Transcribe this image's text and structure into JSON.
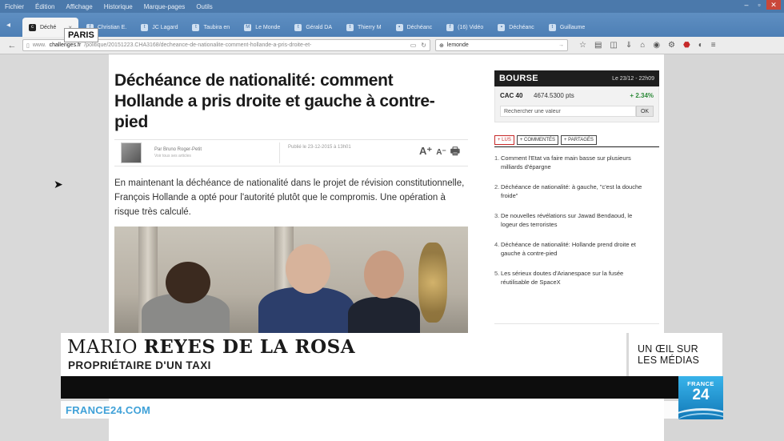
{
  "menubar": [
    "Fichier",
    "Édition",
    "Affichage",
    "Historique",
    "Marque-pages",
    "Outils"
  ],
  "tabs": [
    {
      "label": "Déché",
      "icon": "challenges-icon",
      "active": true
    },
    {
      "label": "Christian E.",
      "icon": "facebook-icon"
    },
    {
      "label": "JC Lagard",
      "icon": "twitter-icon"
    },
    {
      "label": "Taubira en",
      "icon": "twitter-icon"
    },
    {
      "label": "Le Monde",
      "icon": "lemonde-icon"
    },
    {
      "label": "Gérald DA",
      "icon": "twitter-icon"
    },
    {
      "label": "Thierry M",
      "icon": "twitter-icon"
    },
    {
      "label": "Déchéanc",
      "icon": "page-icon"
    },
    {
      "label": "(16) Vidéo",
      "icon": "facebook-icon"
    },
    {
      "label": "Déchéanc",
      "icon": "page-icon"
    },
    {
      "label": "Guillaume",
      "icon": "twitter-icon"
    }
  ],
  "location_badge": "PARIS",
  "url": {
    "prefix": "www.",
    "domain": "challenges.fr",
    "path": "/politique/20151223.CHA3168/decheance-de-nationalite-comment-hollande-a-pris-droite-et-"
  },
  "search": {
    "value": "lemonde"
  },
  "article": {
    "headline": "Déchéance de nationalité: comment Hollande a pris droite et gauche à contre-pied",
    "author": "Par Bruno Roger-Petit",
    "author_role": "Voir tous ses articles",
    "published": "Publié le 23-12-2015 à 13h01",
    "tools": {
      "enlarge": "A⁺",
      "shrink": "A⁻",
      "print": "🖶"
    },
    "lede": "En maintenant la déchéance de nationalité dans le projet de révision constitutionnelle, François Hollande a opté pour l'autorité plutôt que le compromis. Une opération à risque très calculé."
  },
  "bourse": {
    "title": "BOURSE",
    "date": "Le 23/12 - 22h09",
    "index": "CAC 40",
    "value": "4674.5300 pts",
    "change": "+ 2.34%",
    "search_value": "Rechercher une valeur",
    "ok": "OK"
  },
  "sidebar_tabs": [
    "+ LUS",
    "+ COMMENTÉS",
    "+ PARTAGÉS"
  ],
  "top_list": [
    "Comment l'Etat va faire main basse sur plusieurs milliards d'épargne",
    "Déchéance de nationalité: à gauche, \"c'est la douche froide\"",
    "De nouvelles révélations sur Jawad Bendaoud, le logeur des terroristes",
    "Déchéance de nationalité: Hollande prend droite et gauche à contre-pied",
    "Les sérieux doutes d'Arianespace sur la fusée réutilisable de SpaceX"
  ],
  "overlay": {
    "name_first": "MARIO",
    "name_last": "REYES DE LA ROSA",
    "role": "PROPRIÉTAIRE D'UN TAXI",
    "show_line1": "UN ŒIL SUR",
    "show_line2": "LES MÉDIAS",
    "site": "FRANCE24.COM",
    "logo_top": "FRANCE",
    "logo_num": "24"
  }
}
